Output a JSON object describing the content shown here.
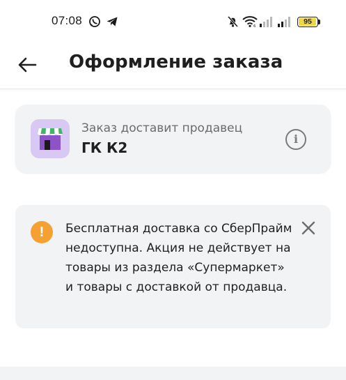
{
  "status_bar": {
    "time": "07:08",
    "icons": [
      "whatsapp-icon",
      "telegram-icon",
      "mute-icon",
      "wifi-icon",
      "signal-icon",
      "signal-icon"
    ],
    "battery": {
      "level_text": "95",
      "level": 0.95,
      "color": "#f0d44a"
    }
  },
  "header": {
    "title": "Оформление заказа",
    "back_icon": "arrow-left-icon"
  },
  "seller_card": {
    "caption": "Заказ доставит продавец",
    "name": "ГК К2",
    "shop_icon": "storefront-icon",
    "info_icon": "info-icon",
    "icon_bg_color": "#d8c8f4"
  },
  "notice": {
    "text": "Бесплатная доставка со СберПрайм недоступна. Акция не действует на товары из раздела «Супермаркет» и товары с доставкой от продавца.",
    "warning_icon": "warning-icon",
    "close_icon": "close-icon",
    "accent_color": "#f5a033"
  }
}
